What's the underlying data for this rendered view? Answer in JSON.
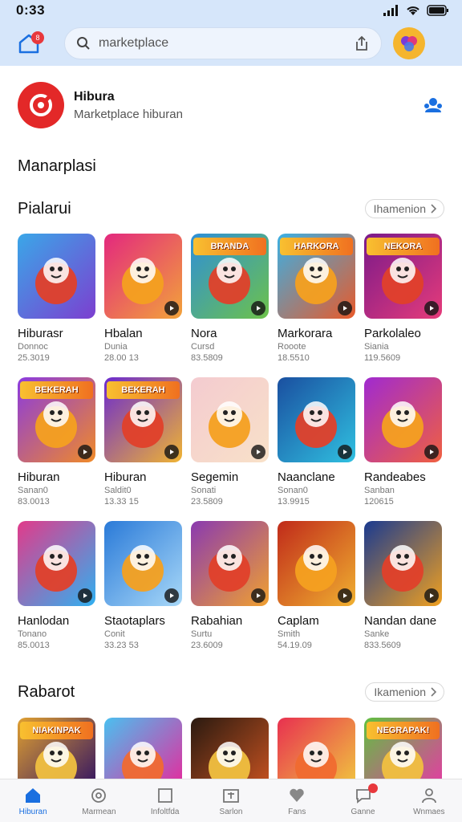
{
  "status": {
    "time": "0:33"
  },
  "header": {
    "search_query": "marketplace",
    "notif_count": "8"
  },
  "app": {
    "name": "Hibura",
    "subtitle": "Marketplace hiburan"
  },
  "page_title": "Manarplasi",
  "sections": [
    {
      "title": "Pialarui",
      "more_label": "Ihamenion"
    },
    {
      "title": "Rabarot",
      "more_label": "Ikamenion"
    }
  ],
  "cards": [
    {
      "title": "Hiburasr",
      "sub": "Donnoc",
      "meta": "25.3019",
      "c1": "#3aa7e8",
      "c2": "#7c3fd0",
      "icon": "bear-character-icon"
    },
    {
      "title": "Hbalan",
      "sub": "Dunia",
      "meta": "28.00 13",
      "c1": "#e3287e",
      "c2": "#f2a33a",
      "icon": "fox-character-icon"
    },
    {
      "title": "Nora",
      "sub": "Cursd",
      "meta": "83.5809",
      "c1": "#2e8fd8",
      "c2": "#6dc24a",
      "icon": "wolf-character-icon",
      "caption": "BRANDA"
    },
    {
      "title": "Markorara",
      "sub": "Rooote",
      "meta": "18.5510",
      "c1": "#3ab0e5",
      "c2": "#e85a2a",
      "icon": "man-character-icon",
      "caption": "HARKORA"
    },
    {
      "title": "Parkolaleo",
      "sub": "Siania",
      "meta": "119.5609",
      "c1": "#7a1a8a",
      "c2": "#e63b7a",
      "icon": "cat-character-icon",
      "caption": "NEKORA"
    },
    {
      "title": "Hiburan",
      "sub": "Sanan0",
      "meta": "83.0013",
      "c1": "#8a3ae0",
      "c2": "#f08a28",
      "icon": "bear-game-icon",
      "caption": "BEKERAH"
    },
    {
      "title": "Hiburan",
      "sub": "Saldit0",
      "meta": "13.33 15",
      "c1": "#6a2ad0",
      "c2": "#f0b432",
      "icon": "kid-character-icon",
      "caption": "BEKERAH"
    },
    {
      "title": "Segemin",
      "sub": "Sonati",
      "meta": "23.5809",
      "c1": "#f4cbd0",
      "c2": "#f8e1c8",
      "icon": "person-photo-icon"
    },
    {
      "title": "Naanclane",
      "sub": "Sonan0",
      "meta": "13.9915",
      "c1": "#1a4fa0",
      "c2": "#30c0e0",
      "icon": "play-medal-icon"
    },
    {
      "title": "Randeabes",
      "sub": "Sanban",
      "meta": "120615",
      "c1": "#a02ad0",
      "c2": "#f06040",
      "icon": "cat-hero-icon"
    },
    {
      "title": "Hanlodan",
      "sub": "Tonano",
      "meta": "85.0013",
      "c1": "#e23a8a",
      "c2": "#30b0f0",
      "icon": "boy-character-icon"
    },
    {
      "title": "Staotaplars",
      "sub": "Conit",
      "meta": "33.23 53",
      "c1": "#2a7ad8",
      "c2": "#a8d8f8",
      "icon": "seal-character-icon"
    },
    {
      "title": "Rabahian",
      "sub": "Surtu",
      "meta": "23.6009",
      "c1": "#8a3ab0",
      "c2": "#f0a030",
      "icon": "raccoon-character-icon"
    },
    {
      "title": "Caplam",
      "sub": "Smith",
      "meta": "54.19.09",
      "c1": "#c02a1a",
      "c2": "#f0b030",
      "icon": "warrior-character-icon"
    },
    {
      "title": "Nandan dane",
      "sub": "Sanke",
      "meta": "833.5609",
      "c1": "#1a3a90",
      "c2": "#f0a020",
      "icon": "shield-emblem-icon"
    }
  ],
  "partial_cards": [
    {
      "c1": "#e0a030",
      "c2": "#3a1a60",
      "caption": "NIAKINPAK",
      "icon": "girl-character-icon"
    },
    {
      "c1": "#4ac0f0",
      "c2": "#e030a0",
      "icon": "diver-character-icon"
    },
    {
      "c1": "#2a1a10",
      "c2": "#c05020",
      "icon": "play-medal-icon"
    },
    {
      "c1": "#e83050",
      "c2": "#f0c040",
      "icon": "boy-character-icon"
    },
    {
      "c1": "#60c040",
      "c2": "#e040a0",
      "caption": "NEGRAPAK!",
      "icon": "monster-group-icon"
    }
  ],
  "tabs": [
    {
      "label": "Hiburan",
      "icon": "home-icon",
      "active": true
    },
    {
      "label": "Marmean",
      "icon": "target-icon"
    },
    {
      "label": "Infoltfda",
      "icon": "square-icon"
    },
    {
      "label": "Sarlon",
      "icon": "calendar-icon"
    },
    {
      "label": "Fans",
      "icon": "heart-icon"
    },
    {
      "label": "Ganne",
      "icon": "chat-icon",
      "badge": true
    },
    {
      "label": "Wnmaes",
      "icon": "profile-icon"
    }
  ]
}
